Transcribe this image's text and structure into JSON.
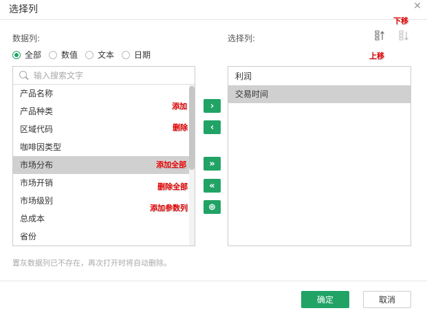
{
  "dialog": {
    "title": "选择列"
  },
  "left": {
    "label": "数据列:",
    "radios": [
      {
        "label": "全部",
        "checked": true
      },
      {
        "label": "数值",
        "checked": false
      },
      {
        "label": "文本",
        "checked": false
      },
      {
        "label": "日期",
        "checked": false
      }
    ],
    "search_placeholder": "输入搜索文字",
    "items": [
      "产品名称",
      "产品种类",
      "区域代码",
      "咖啡因类型",
      "市场分布",
      "市场开销",
      "市场级别",
      "总成本",
      "省份"
    ],
    "selected": "市场分布"
  },
  "right": {
    "label": "选择列:",
    "items": [
      "利润",
      "交易时间"
    ],
    "selected": "交易时间"
  },
  "buttons": {
    "add": "›",
    "remove": "‹",
    "add_all": "»",
    "remove_all": "«",
    "add_param": "⊕"
  },
  "annotations": {
    "move_down": "下移",
    "move_up": "上移",
    "add": "添加",
    "remove": "删除",
    "add_all": "添加全部",
    "remove_all": "删除全部",
    "add_param_col": "添加参数列"
  },
  "hint": "置灰数据列已不存在，再次打开时将自动删除。",
  "footer": {
    "ok": "确定",
    "cancel": "取消"
  },
  "colors": {
    "accent": "#21a366",
    "annotation": "#e00000",
    "selected_row": "#d0d0d0"
  }
}
